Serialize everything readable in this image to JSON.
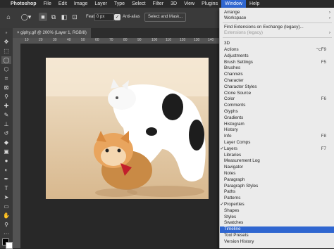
{
  "menubar": {
    "items": [
      {
        "label": "Photoshop"
      },
      {
        "label": "File"
      },
      {
        "label": "Edit"
      },
      {
        "label": "Image"
      },
      {
        "label": "Layer"
      },
      {
        "label": "Type"
      },
      {
        "label": "Select"
      },
      {
        "label": "Filter"
      },
      {
        "label": "3D"
      },
      {
        "label": "View"
      },
      {
        "label": "Plugins"
      },
      {
        "label": "Window"
      },
      {
        "label": "Help"
      }
    ]
  },
  "options": {
    "feather_label": "Feather:",
    "feather_value": "0 px",
    "antialias_label": "Anti-alias",
    "select_mask_label": "Select and Mask..."
  },
  "document": {
    "tab_title": "giphy.gif @ 200% (Layer 1, RGB/8)",
    "ruler_marks": [
      "10",
      "20",
      "30",
      "40",
      "50",
      "60",
      "70",
      "80",
      "90",
      "100",
      "110",
      "120",
      "130",
      "140"
    ]
  },
  "window_menu": {
    "items": [
      {
        "label": "Arrange",
        "arrow": "›"
      },
      {
        "label": "Workspace",
        "arrow": "›"
      },
      {
        "label": "Find Extensions on Exchange (legacy)..."
      },
      {
        "label": "Extensions (legacy)",
        "arrow": "›",
        "disabled": true
      },
      {
        "label": "3D"
      },
      {
        "label": "Actions",
        "shortcut": "⌥F9"
      },
      {
        "label": "Adjustments"
      },
      {
        "label": "Brush Settings",
        "shortcut": "F5"
      },
      {
        "label": "Brushes"
      },
      {
        "label": "Channels"
      },
      {
        "label": "Character"
      },
      {
        "label": "Character Styles"
      },
      {
        "label": "Clone Source"
      },
      {
        "label": "Color",
        "shortcut": "F6"
      },
      {
        "label": "Comments"
      },
      {
        "label": "Glyphs"
      },
      {
        "label": "Gradients"
      },
      {
        "label": "Histogram"
      },
      {
        "label": "History"
      },
      {
        "label": "Info",
        "shortcut": "F8"
      },
      {
        "label": "Layer Comps"
      },
      {
        "label": "Layers",
        "shortcut": "F7",
        "checked": true
      },
      {
        "label": "Libraries"
      },
      {
        "label": "Measurement Log"
      },
      {
        "label": "Navigator"
      },
      {
        "label": "Notes"
      },
      {
        "label": "Paragraph"
      },
      {
        "label": "Paragraph Styles"
      },
      {
        "label": "Paths"
      },
      {
        "label": "Patterns"
      },
      {
        "label": "Properties",
        "checked": true
      },
      {
        "label": "Shapes"
      },
      {
        "label": "Styles"
      },
      {
        "label": "Swatches"
      },
      {
        "label": "Timeline",
        "selected": true
      },
      {
        "label": "Tool Presets"
      },
      {
        "label": "Version History"
      }
    ]
  },
  "colors": {
    "menu_highlight": "#2f66d0",
    "menu_background": "#ebebeb",
    "panel_background": "#383838"
  }
}
